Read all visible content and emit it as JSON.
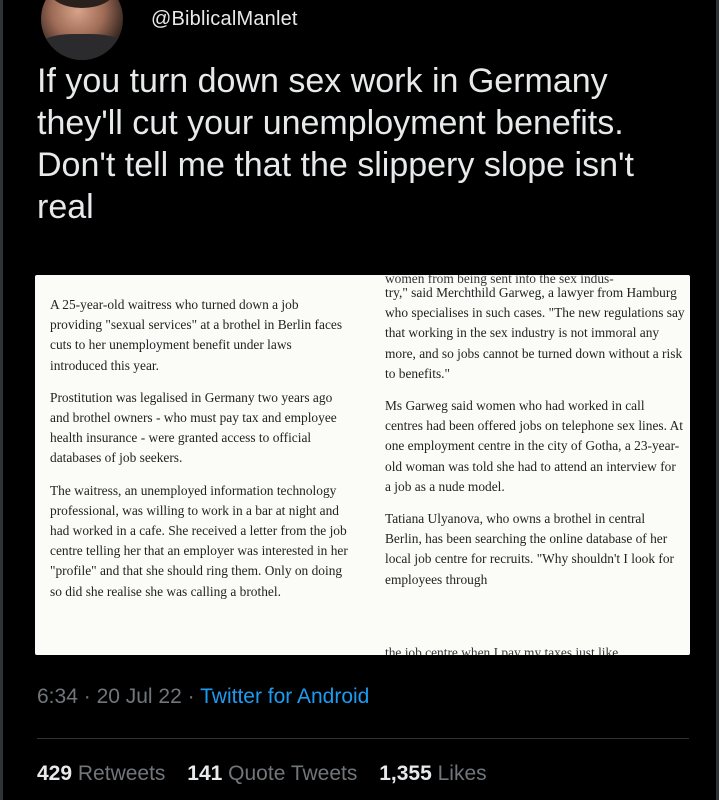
{
  "author": {
    "handle": "@BiblicalManlet"
  },
  "tweet": {
    "text": "If you turn down sex work in Germany they'll cut your unemployment benefits. Don't tell me that the slippery slope isn't real"
  },
  "article": {
    "col1": [
      "A 25-year-old waitress who turned down a job providing \"sexual services\" at a brothel in Berlin faces cuts to her unemployment benefit under laws introduced this year.",
      "Prostitution was legalised in Germany two years ago and brothel owners - who must pay tax and employee health insurance - were granted access to official databases of job seekers.",
      "The waitress, an unemployed information technology professional, was willing to work in a bar at night and had worked in a cafe. She received a letter from the job centre telling her that an employer was interested in her \"profile\" and that she should ring them. Only on doing so did she realise she was calling a brothel."
    ],
    "col2_cut_top": "women from being sent into the sex indus-",
    "col2": [
      "try,\" said Merchthild Garweg, a lawyer from Hamburg who specialises in such cases. \"The new regulations say that working in the sex industry is not immoral any more, and so jobs cannot be turned down without a risk to benefits.\"",
      "Ms Garweg said women who had worked in call centres had been offered jobs on telephone sex lines. At one employment centre in the city of Gotha, a 23-year-old woman was told she had to attend an interview for a job as a nude model.",
      "Tatiana Ulyanova, who owns a brothel in central Berlin, has been searching the online database of her local job centre for recruits. \"Why shouldn't I look for employees through"
    ],
    "col2_cut_bottom": "the job centre when I pay my taxes just like"
  },
  "meta": {
    "time": "6:34",
    "sep1": "·",
    "date": "20 Jul 22",
    "sep2": "·",
    "client": "Twitter for Android"
  },
  "stats": {
    "retweets_count": "429",
    "retweets_label": "Retweets",
    "quotes_count": "141",
    "quotes_label": "Quote Tweets",
    "likes_count": "1,355",
    "likes_label": "Likes"
  }
}
